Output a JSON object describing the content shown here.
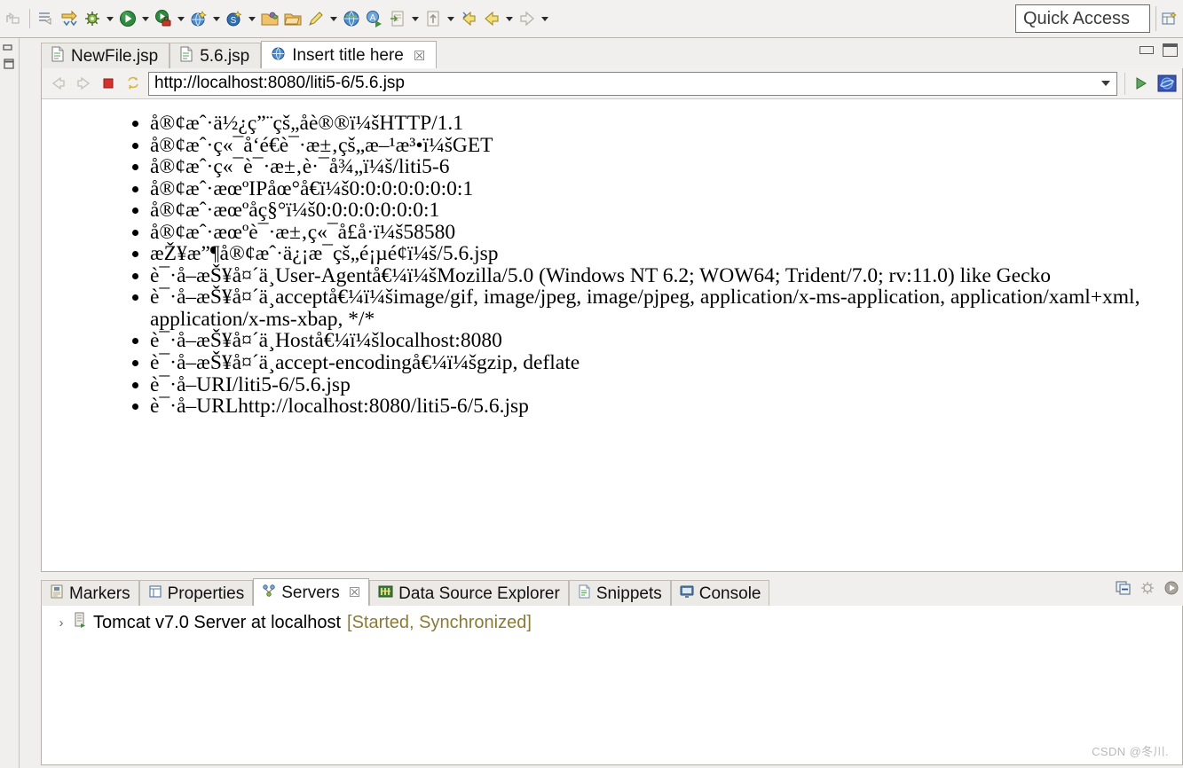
{
  "toolbar": {
    "items": [
      {
        "name": "edit-undo-icon",
        "glyph": "edit",
        "arrow": false
      },
      {
        "name": "toolbar-separator",
        "glyph": "sep",
        "arrow": false
      },
      {
        "name": "new-wizard-icon",
        "glyph": "newwiz",
        "arrow": false
      },
      {
        "name": "export-icon",
        "glyph": "export",
        "arrow": false
      },
      {
        "name": "debug-icon",
        "glyph": "bug",
        "arrow": true
      },
      {
        "name": "run-icon",
        "glyph": "run",
        "arrow": true
      },
      {
        "name": "run-secure-icon",
        "glyph": "runlock",
        "arrow": true
      },
      {
        "name": "open-browser-icon",
        "glyph": "globenew",
        "arrow": true
      },
      {
        "name": "search-money-icon",
        "glyph": "globes",
        "arrow": true
      },
      {
        "name": "open-folder-icon",
        "glyph": "folderopen",
        "arrow": false
      },
      {
        "name": "folder-icon",
        "glyph": "folder",
        "arrow": false
      },
      {
        "name": "pencil-icon",
        "glyph": "pencil",
        "arrow": true
      },
      {
        "name": "web-globe-icon",
        "glyph": "globe",
        "arrow": false
      },
      {
        "name": "validate-icon",
        "glyph": "validate",
        "arrow": false
      },
      {
        "name": "annotation-icon",
        "glyph": "annot",
        "arrow": true
      },
      {
        "name": "upload-icon",
        "glyph": "upload",
        "arrow": true
      },
      {
        "name": "back-yellow-icon",
        "glyph": "backy",
        "arrow": false
      },
      {
        "name": "prev-annotation-icon",
        "glyph": "prev",
        "arrow": true
      },
      {
        "name": "next-annotation-icon",
        "glyph": "next",
        "arrow": true
      }
    ],
    "quick_access_placeholder": "Quick Access"
  },
  "editor": {
    "tabs": [
      {
        "label": "NewFile.jsp",
        "icon": "jsp-file-icon",
        "active": false,
        "closable": false
      },
      {
        "label": "5.6.jsp",
        "icon": "jsp-file-icon",
        "active": false,
        "closable": false
      },
      {
        "label": "Insert title here",
        "icon": "web-browser-icon",
        "active": true,
        "closable": true
      }
    ],
    "close_glyph": "☒"
  },
  "browser": {
    "url": "http://localhost:8080/liti5-6/5.6.jsp",
    "nav": {
      "back": "back-icon",
      "forward": "forward-icon",
      "stop": "stop-icon",
      "refresh": "refresh-icon",
      "go": "go-icon",
      "open_external": "open-external-browser-icon"
    },
    "content_lines": [
      "å®¢æˆ·ä½¿ç”¨çš„åè®®ï¼šHTTP/1.1",
      "å®¢æˆ·ç«¯å‘é€è¯·æ±‚çš„æ–¹æ³•ï¼šGET",
      "å®¢æˆ·ç«¯è¯·æ±‚è·¯å¾„ï¼š/liti5-6",
      "å®¢æˆ·æœºIPåœ°å€ï¼š0:0:0:0:0:0:0:1",
      "å®¢æˆ·æœºåç§°ï¼š0:0:0:0:0:0:0:1",
      "å®¢æˆ·æœºè¯·æ±‚ç«¯å£å·ï¼š58580",
      "æŽ¥æ”¶å®¢æˆ·ä¿¡æ¯çš„é¡µé¢ï¼š/5.6.jsp",
      "è¯·å–æŠ¥å¤´ä¸­User-Agentå€¼ï¼šMozilla/5.0 (Windows NT 6.2; WOW64; Trident/7.0; rv:11.0) like Gecko",
      "è¯·å–æŠ¥å¤´ä¸­acceptå€¼ï¼šimage/gif, image/jpeg, image/pjpeg, application/x-ms-application, application/xaml+xml, application/x-ms-xbap, */*",
      "è¯·å–æŠ¥å¤´ä¸­Hostå€¼ï¼šlocalhost:8080",
      "è¯·å–æŠ¥å¤´ä¸­accept-encodingå€¼ï¼šgzip, deflate",
      "è¯·å–URI/liti5-6/5.6.jsp",
      "è¯·å–URLhttp://localhost:8080/liti5-6/5.6.jsp"
    ]
  },
  "bottom_panel": {
    "tabs": [
      {
        "label": "Markers",
        "icon": "markers-icon",
        "active": false,
        "closable": false
      },
      {
        "label": "Properties",
        "icon": "properties-icon",
        "active": false,
        "closable": false
      },
      {
        "label": "Servers",
        "icon": "servers-icon",
        "active": true,
        "closable": true
      },
      {
        "label": "Data Source Explorer",
        "icon": "datasource-icon",
        "active": false,
        "closable": false
      },
      {
        "label": "Snippets",
        "icon": "snippets-icon",
        "active": false,
        "closable": false
      },
      {
        "label": "Console",
        "icon": "console-icon",
        "active": false,
        "closable": false
      }
    ],
    "close_glyph": "☒",
    "server": {
      "twisty": "›",
      "name": "Tomcat v7.0 Server at localhost",
      "status": "[Started, Synchronized]",
      "status_color": "#8a7a35"
    }
  },
  "watermark": "CSDN @冬川."
}
